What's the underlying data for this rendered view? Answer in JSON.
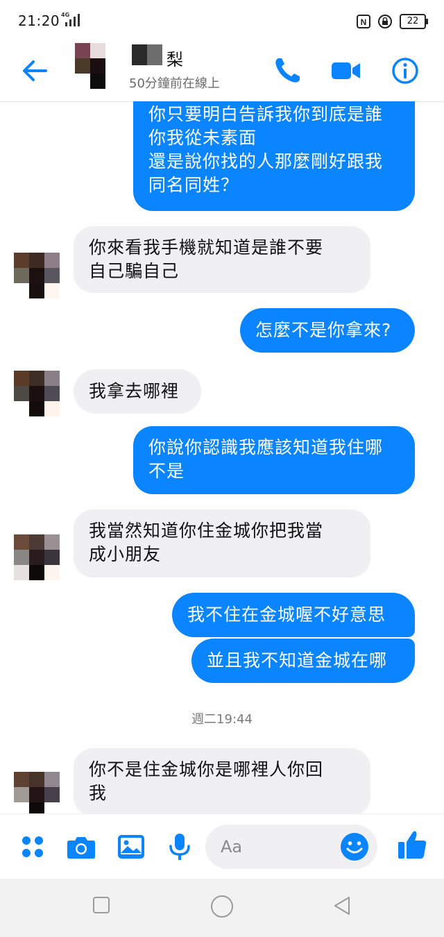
{
  "status": {
    "time": "21:20",
    "network": "4G",
    "nfc_label": "N",
    "battery": "22"
  },
  "header": {
    "contact_name": "梨",
    "last_seen": "50分鐘前在線上"
  },
  "messages": [
    {
      "side": "out",
      "text": "你只要明白告訴我你到底是誰\n你我從未素面\n還是說你找的人那麼剛好跟我\n同名同姓？"
    },
    {
      "side": "in",
      "text": "你來看我手機就知道是誰不要\n自己騙自己"
    },
    {
      "side": "out",
      "text": "怎麼不是你拿來?"
    },
    {
      "side": "in",
      "text": "我拿去哪裡"
    },
    {
      "side": "out",
      "text": "你說你認識我應該知道我住哪\n不是"
    },
    {
      "side": "in",
      "text": "我當然知道你住金城你把我當\n成小朋友"
    },
    {
      "side": "out",
      "text": "我不住在金城喔不好意思"
    },
    {
      "side": "out",
      "text": "並且我不知道金城在哪"
    },
    {
      "side": "in",
      "text": "你不是住金城你是哪裡人你回\n我"
    }
  ],
  "timestamp": "週二19:44",
  "composer": {
    "placeholder": "Aa"
  },
  "colors": {
    "accent": "#0a84ff",
    "incoming_bubble": "#f0f0f2"
  },
  "icons": [
    "back-arrow-icon",
    "phone-icon",
    "video-camera-icon",
    "info-icon",
    "apps-grid-icon",
    "camera-icon",
    "gallery-icon",
    "microphone-icon",
    "emoji-icon",
    "thumbs-up-icon",
    "square-icon",
    "circle-icon",
    "triangle-back-icon"
  ]
}
